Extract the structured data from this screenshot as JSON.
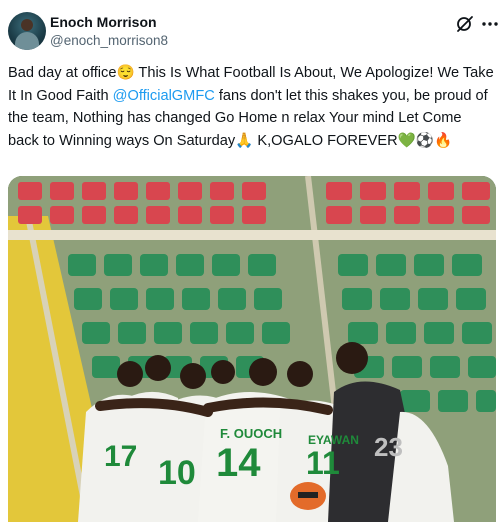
{
  "author": {
    "name": "Enoch Morrison",
    "handle": "@enoch_morrison8"
  },
  "tweet": {
    "part1": "Bad day at office😌 This Is What Football Is About, We Apologize! We Take It In Good Faith ",
    "mention": "@OfficialGMFC",
    "part2": " fans don't let this shakes you, be proud of the team, Nothing has changed Go Home n relax Your mind Let Come back to Winning ways On Saturday🙏 K,OGALO FOREVER💚⚽🔥"
  },
  "photo": {
    "jerseys": [
      {
        "number": "17",
        "name": ""
      },
      {
        "number": "10",
        "name": ""
      },
      {
        "number": "14",
        "name": "F. OUOCH"
      },
      {
        "number": "11",
        "name": "EYAWAN"
      },
      {
        "number": "23",
        "name": ""
      }
    ]
  },
  "icons": [
    "grok-icon",
    "more-icon"
  ],
  "colors": {
    "mention": "#1d9bf0",
    "jersey_white": "#f2f2ee",
    "jersey_green": "#1f8a3a",
    "seat_green": "#2f8f5a",
    "seat_red": "#d8464f"
  }
}
